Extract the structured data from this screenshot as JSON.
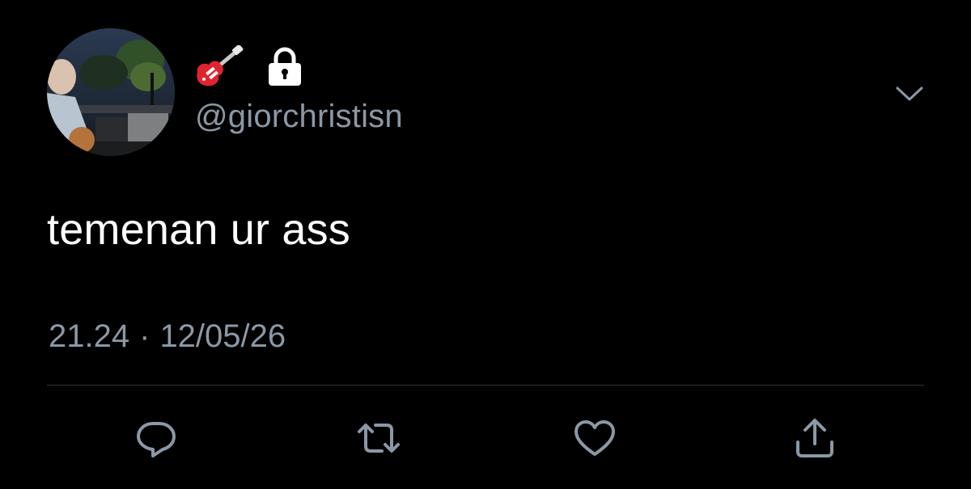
{
  "tweet": {
    "display_name_emoji": "guitar",
    "protected_icon": "lock-icon",
    "handle": "@giorchristisn",
    "text": "temenan ur ass",
    "time": "21.24",
    "separator": "·",
    "date": "12/05/26"
  },
  "actions": {
    "reply_icon": "reply-icon",
    "retweet_icon": "retweet-icon",
    "like_icon": "heart-icon",
    "share_icon": "share-icon"
  },
  "colors": {
    "background": "#000000",
    "text": "#ffffff",
    "secondary": "#8b98a5",
    "divider": "#2f3336",
    "icon": "#8b98a5"
  }
}
